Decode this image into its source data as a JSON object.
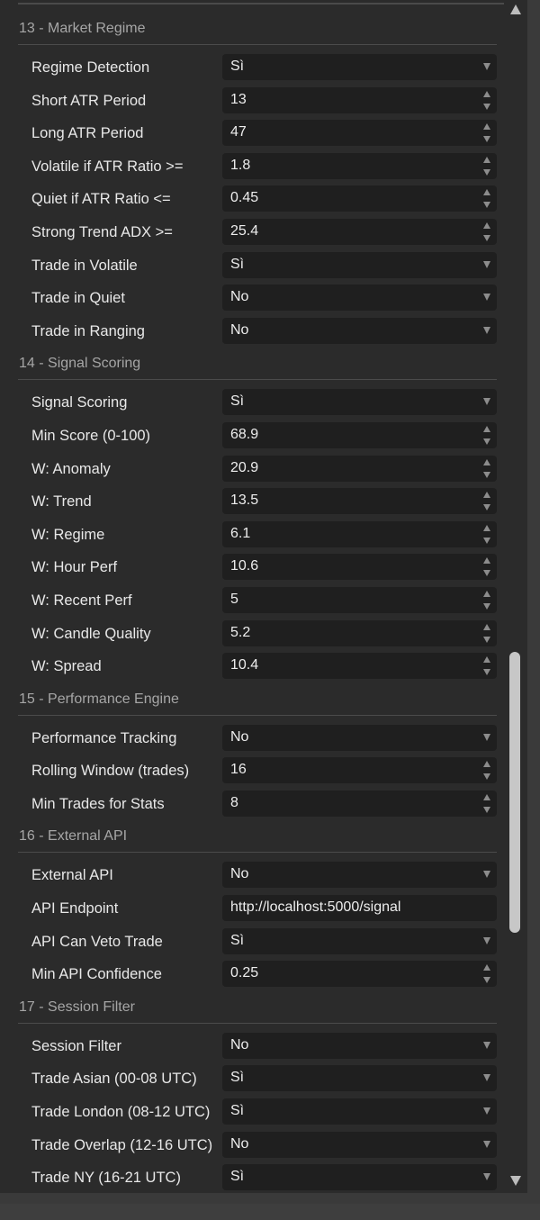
{
  "sections": [
    {
      "title": "13 - Market Regime",
      "rows": [
        {
          "label": "Regime Detection",
          "value": "Sì",
          "type": "select"
        },
        {
          "label": "Short ATR Period",
          "value": "13",
          "type": "number"
        },
        {
          "label": "Long ATR Period",
          "value": "47",
          "type": "number"
        },
        {
          "label": "Volatile if ATR Ratio >=",
          "value": "1.8",
          "type": "number"
        },
        {
          "label": "Quiet if ATR Ratio <=",
          "value": "0.45",
          "type": "number"
        },
        {
          "label": "Strong Trend ADX >=",
          "value": "25.4",
          "type": "number"
        },
        {
          "label": "Trade in Volatile",
          "value": "Sì",
          "type": "select"
        },
        {
          "label": "Trade in Quiet",
          "value": "No",
          "type": "select"
        },
        {
          "label": "Trade in Ranging",
          "value": "No",
          "type": "select"
        }
      ]
    },
    {
      "title": "14 - Signal Scoring",
      "rows": [
        {
          "label": "Signal Scoring",
          "value": "Sì",
          "type": "select"
        },
        {
          "label": "Min Score (0-100)",
          "value": "68.9",
          "type": "number"
        },
        {
          "label": "W: Anomaly",
          "value": "20.9",
          "type": "number"
        },
        {
          "label": "W: Trend",
          "value": "13.5",
          "type": "number"
        },
        {
          "label": "W: Regime",
          "value": "6.1",
          "type": "number"
        },
        {
          "label": "W: Hour Perf",
          "value": "10.6",
          "type": "number"
        },
        {
          "label": "W: Recent Perf",
          "value": "5",
          "type": "number"
        },
        {
          "label": "W: Candle Quality",
          "value": "5.2",
          "type": "number"
        },
        {
          "label": "W: Spread",
          "value": "10.4",
          "type": "number"
        }
      ]
    },
    {
      "title": "15 - Performance Engine",
      "rows": [
        {
          "label": "Performance Tracking",
          "value": "No",
          "type": "select"
        },
        {
          "label": "Rolling Window (trades)",
          "value": "16",
          "type": "number"
        },
        {
          "label": "Min Trades for Stats",
          "value": "8",
          "type": "number"
        }
      ]
    },
    {
      "title": "16 - External API",
      "rows": [
        {
          "label": "External API",
          "value": "No",
          "type": "select"
        },
        {
          "label": "API Endpoint",
          "value": "http://localhost:5000/signal",
          "type": "text"
        },
        {
          "label": "API Can Veto Trade",
          "value": "Sì",
          "type": "select"
        },
        {
          "label": "Min API Confidence",
          "value": "0.25",
          "type": "number"
        }
      ]
    },
    {
      "title": "17 - Session Filter",
      "rows": [
        {
          "label": "Session Filter",
          "value": "No",
          "type": "select"
        },
        {
          "label": "Trade Asian (00-08 UTC)",
          "value": "Sì",
          "type": "select"
        },
        {
          "label": "Trade London (08-12 UTC)",
          "value": "Sì",
          "type": "select"
        },
        {
          "label": "Trade Overlap (12-16 UTC)",
          "value": "No",
          "type": "select"
        },
        {
          "label": "Trade NY (16-21 UTC)",
          "value": "Sì",
          "type": "select"
        }
      ]
    }
  ],
  "icons": {
    "select": "chevron-down-icon",
    "number": "spinner-arrows-icon",
    "scroll_up": "scroll-up-arrow-icon",
    "scroll_down": "scroll-down-arrow-icon"
  },
  "colors": {
    "panel_bg": "#2b2b2b",
    "input_bg": "#1f1f1f",
    "label_text": "#e8e8e8",
    "section_text": "#a6a6a6",
    "scroll_thumb": "#c7c7c7"
  }
}
